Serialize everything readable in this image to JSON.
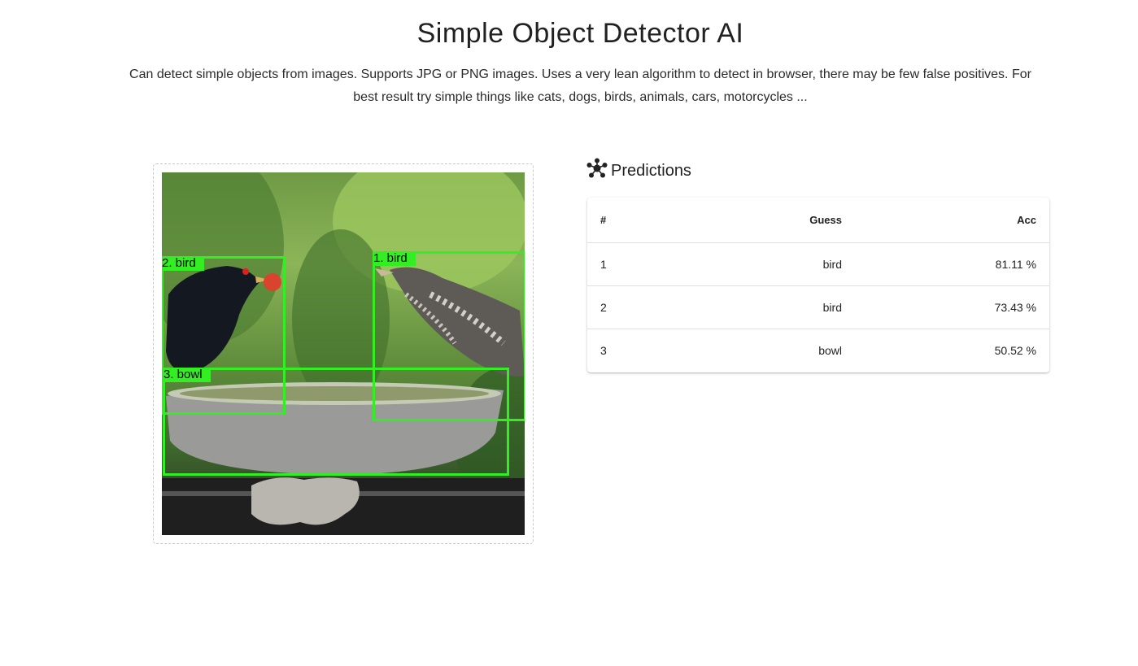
{
  "header": {
    "title": "Simple Object Detector AI",
    "description": "Can detect simple objects from images. Supports JPG or PNG images. Uses a very lean algorithm to detect in browser, there may be few false positives. For best result try simple things like cats, dogs, birds, animals, cars, motorcycles ..."
  },
  "image_panel": {
    "detections": [
      {
        "label": "1. bird"
      },
      {
        "label": "2. bird"
      },
      {
        "label": "3. bowl"
      }
    ],
    "box_color": "#33ee22"
  },
  "predictions": {
    "icon": "hub-icon",
    "title": "Predictions",
    "columns": {
      "num": "#",
      "guess": "Guess",
      "acc": "Acc"
    },
    "rows": [
      {
        "num": "1",
        "guess": "bird",
        "acc": "81.11 %"
      },
      {
        "num": "2",
        "guess": "bird",
        "acc": "73.43 %"
      },
      {
        "num": "3",
        "guess": "bowl",
        "acc": "50.52 %"
      }
    ]
  }
}
